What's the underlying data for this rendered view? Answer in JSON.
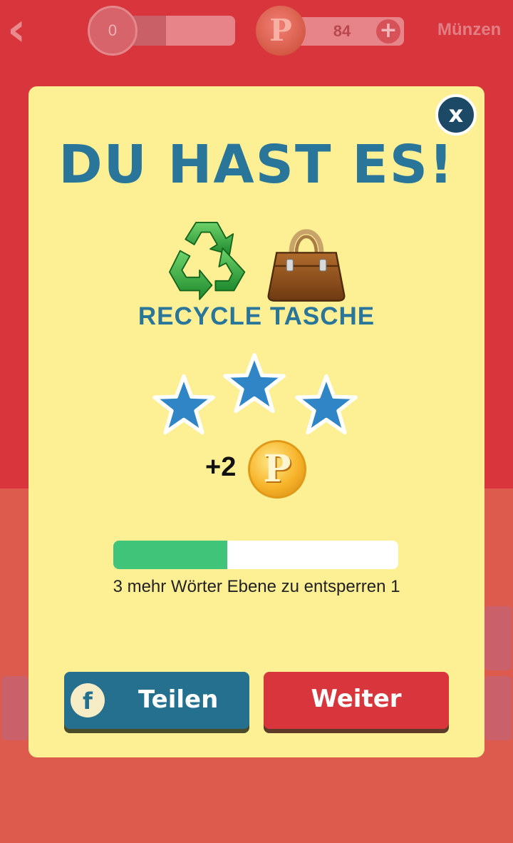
{
  "topbar": {
    "back_icon": "‹",
    "hint_value": "0",
    "coin_symbol": "P",
    "coin_count": "84",
    "plus_icon": "+",
    "coins_label": "Münzen"
  },
  "modal": {
    "close_label": "x",
    "title": "DU HAST ES!",
    "emojis": [
      "recycle-symbol",
      "handbag"
    ],
    "answer": "RECYCLE TASCHE",
    "stars_earned": 3,
    "reward_amount": "+2",
    "reward_coin_symbol": "P",
    "progress_fraction": 0.4,
    "progress_text": "3 mehr Wörter Ebene zu entsperren 1",
    "share_icon": "f",
    "share_label": "Teilen",
    "next_label": "Weiter"
  },
  "colors": {
    "background_red": "#d8363c",
    "modal_yellow": "#fdef93",
    "title_blue": "#2a769b",
    "star_blue": "#2f85c5",
    "progress_green": "#3fc47a",
    "share_blue": "#25708f",
    "next_red": "#d8363c"
  }
}
